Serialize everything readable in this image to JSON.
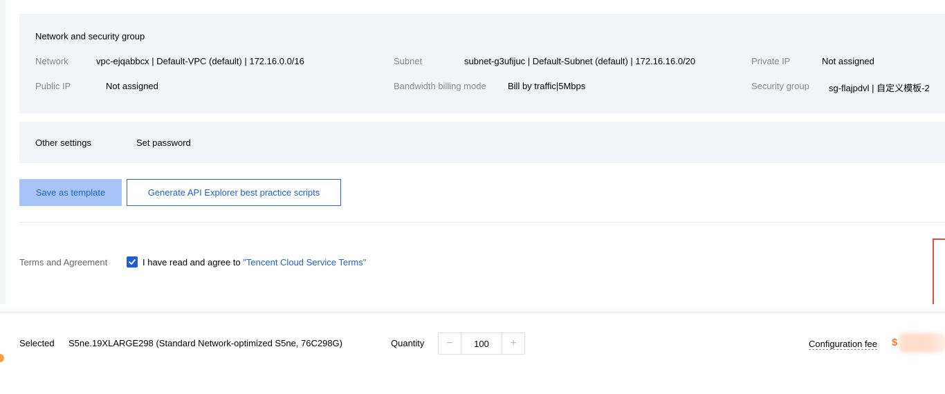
{
  "network_section": {
    "title": "Network and security group",
    "network_label": "Network",
    "network_value": "vpc-ejqabbcx | Default-VPC (default) | 172.16.0.0/16",
    "subnet_label": "Subnet",
    "subnet_value": "subnet-g3ufijuc | Default-Subnet (default) | 172.16.16.0/20",
    "private_ip_label": "Private IP",
    "private_ip_value": "Not assigned",
    "public_ip_label": "Public IP",
    "public_ip_value": "Not assigned",
    "bandwidth_label": "Bandwidth billing mode",
    "bandwidth_value": "Bill by traffic|5Mbps",
    "security_group_label": "Security group",
    "security_group_value": "sg-flajpdvl | 自定义模板-2"
  },
  "other_section": {
    "title": "Other settings",
    "value": "Set password"
  },
  "actions": {
    "save_template_label": "Save as template",
    "api_explorer_label": "Generate API Explorer best practice scripts"
  },
  "terms": {
    "label": "Terms and Agreement",
    "checked": true,
    "text": "I have read and agree to ",
    "link_text": "\"Tencent Cloud Service Terms\""
  },
  "footer": {
    "selected_label": "Selected",
    "selected_value": "S5ne.19XLARGE298 (Standard Network-optimized S5ne, 76C298G)",
    "quantity_label": "Quantity",
    "quantity_value": "100",
    "minus_symbol": "−",
    "plus_symbol": "+",
    "fee_label": "Configuration fee",
    "fee_currency": "$"
  },
  "colors": {
    "accent": "#1f5ed6",
    "panel_bg": "#f3f4f7",
    "fee": "#ff7a2f",
    "highlight_box": "#e34d3d"
  }
}
